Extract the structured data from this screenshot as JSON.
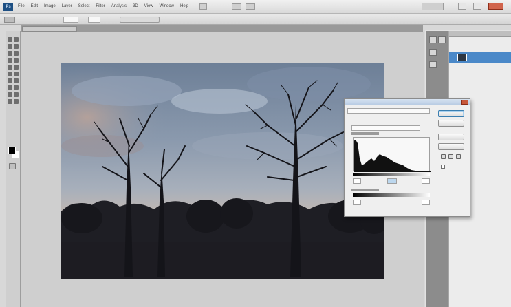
{
  "app": {
    "logo_text": "Ps"
  },
  "menubar": {
    "items": [
      "File",
      "Edit",
      "Image",
      "Layer",
      "Select",
      "Filter",
      "Analysis",
      "3D",
      "View",
      "Window",
      "Help"
    ]
  },
  "icons": {
    "app_logo": "photoshop-logo-icon",
    "zoom": "zoom-icon",
    "arrange": "arrange-documents-icon",
    "screen_mode": "screen-mode-icon",
    "minimize": "minimize-icon",
    "maximize": "maximize-icon",
    "close": "close-icon",
    "eyedropper": "eyedropper-icon"
  },
  "colors": {
    "foreground": "#000000",
    "background": "#ffffff",
    "selected_layer": "#4a88c8"
  },
  "curves_dialog": {
    "channel_value": "RGB"
  }
}
